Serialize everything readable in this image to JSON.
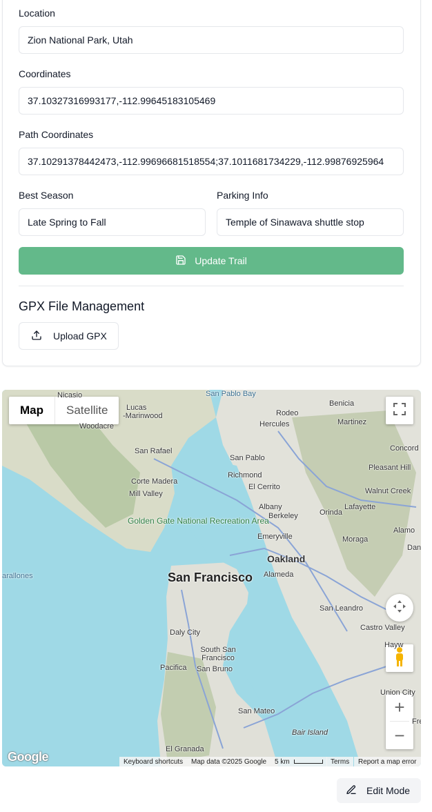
{
  "form": {
    "location_label": "Location",
    "location_value": "Zion National Park, Utah",
    "coordinates_label": "Coordinates",
    "coordinates_value": "37.10327316993177,-112.99645183105469",
    "path_label": "Path Coordinates",
    "path_value": "37.10291378442473,-112.99696681518554;37.1011681734229,-112.99876925964",
    "season_label": "Best Season",
    "season_value": "Late Spring to Fall",
    "parking_label": "Parking Info",
    "parking_value": "Temple of Sinawava shuttle stop",
    "update_label": "Update Trail",
    "update_color": "#63b98a"
  },
  "gpx": {
    "title": "GPX File Management",
    "upload_label": "Upload GPX"
  },
  "map": {
    "type_map": "Map",
    "type_satellite": "Satellite",
    "labels": {
      "nicasio": "Nicasio",
      "lucas": "Lucas",
      "marinwood": "-Marinwood",
      "san_pablo_bay": "San Pablo Bay",
      "benicia": "Benicia",
      "rodeo": "Rodeo",
      "hercules": "Hercules",
      "martinez": "Martinez",
      "woodacre": "Woodacre",
      "concord": "Concord",
      "san_rafael": "San Rafael",
      "san_pablo": "San Pablo",
      "pleasant_hill": "Pleasant Hill",
      "richmond": "Richmond",
      "corte_madera": "Corte Madera",
      "el_cerrito": "El Cerrito",
      "mill_valley": "Mill Valley",
      "walnut_creek": "Walnut Creek",
      "albany": "Albany",
      "lafayette": "Lafayette",
      "berkeley": "Berkeley",
      "orinda": "Orinda",
      "golden_gate": "Golden Gate National Recreation Area",
      "alamo": "Alamo",
      "emeryville": "Emeryville",
      "moraga": "Moraga",
      "dan": "Dan",
      "oakland": "Oakland",
      "farallones": "arallones",
      "san_francisco": "San Francisco",
      "alameda": "Alameda",
      "san_leandro": "San Leandro",
      "castro_valley": "Castro Valley",
      "daly_city": "Daly City",
      "hayward": "Hayw",
      "south_sf": "South San Francisco",
      "pacifica": "Pacifica",
      "san_bruno": "San Bruno",
      "union_city": "Union City",
      "san_mateo": "San Mateo",
      "fre": "Fre",
      "bair_island": "Bair Island",
      "el_granada": "El Granada"
    },
    "attribution": {
      "shortcuts": "Keyboard shortcuts",
      "data": "Map data ©2025 Google",
      "scale": "5 km",
      "terms": "Terms",
      "report": "Report a map error"
    },
    "logo": "Google"
  },
  "edit": {
    "label": "Edit Mode"
  }
}
